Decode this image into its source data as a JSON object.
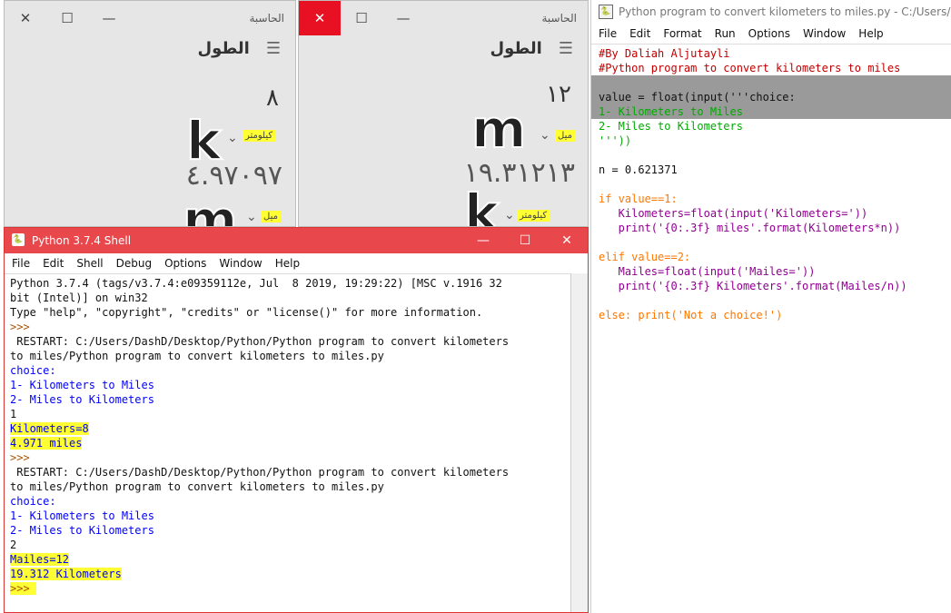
{
  "calc_left": {
    "title": "الحاسبة",
    "mode": "الطول",
    "input_value": "٨",
    "unit_from_label": "كيلومتر",
    "result_value": "٤.٩٧٠٩٧",
    "unit_to_label": "ميل",
    "sym_top": "k",
    "sym_bottom": "m"
  },
  "calc_right": {
    "title": "الحاسبة",
    "mode": "الطول",
    "input_value": "١٢",
    "unit_from_label": "ميل",
    "result_value": "١٩.٣١٢١٣",
    "unit_to_label": "كيلومتر",
    "sym_top": "m",
    "sym_bottom": "k"
  },
  "editor": {
    "title": "Python program to convert kilometers to miles.py - C:/Users/DashD/D",
    "menu": [
      "File",
      "Edit",
      "Format",
      "Run",
      "Options",
      "Window",
      "Help"
    ],
    "lines": [
      "#By Daliah Aljutayli",
      "#Python program to convert kilometers to miles",
      "",
      "value = float(input('''choice:",
      "1- Kilometers to Miles",
      "2- Miles to Kilometers",
      "'''))",
      "",
      "n = 0.621371",
      "",
      "if value==1:",
      "   Kilometers=float(input('Kilometers='))",
      "   print('{0:.3f} miles'.format(Kilometers*n))",
      "",
      "elif value==2:",
      "   Mailes=float(input('Mailes='))",
      "   print('{0:.3f} Kilometers'.format(Mailes/n))",
      "",
      "else: print('Not a choice!')"
    ]
  },
  "shell": {
    "title": "Python 3.7.4 Shell",
    "menu": [
      "File",
      "Edit",
      "Shell",
      "Debug",
      "Options",
      "Window",
      "Help"
    ],
    "lines": [
      "Python 3.7.4 (tags/v3.7.4:e09359112e, Jul  8 2019, 19:29:22) [MSC v.1916 32",
      "bit (Intel)] on win32",
      "Type \"help\", \"copyright\", \"credits\" or \"license()\" for more information.",
      ">>> ",
      " RESTART: C:/Users/DashD/Desktop/Python/Python program to convert kilometers",
      "to miles/Python program to convert kilometers to miles.py",
      "choice:",
      "1- Kilometers to Miles",
      "2- Miles to Kilometers",
      "1",
      "Kilometers=8",
      "4.971 miles",
      ">>> ",
      " RESTART: C:/Users/DashD/Desktop/Python/Python program to convert kilometers",
      "to miles/Python program to convert kilometers to miles.py",
      "choice:",
      "1- Kilometers to Miles",
      "2- Miles to Kilometers",
      "2",
      "Mailes=12",
      "19.312 Kilometers",
      ">>> "
    ]
  },
  "colors": {
    "highlight": "#ffff33",
    "shell_title": "#e8484c",
    "close_red": "#e81123"
  }
}
